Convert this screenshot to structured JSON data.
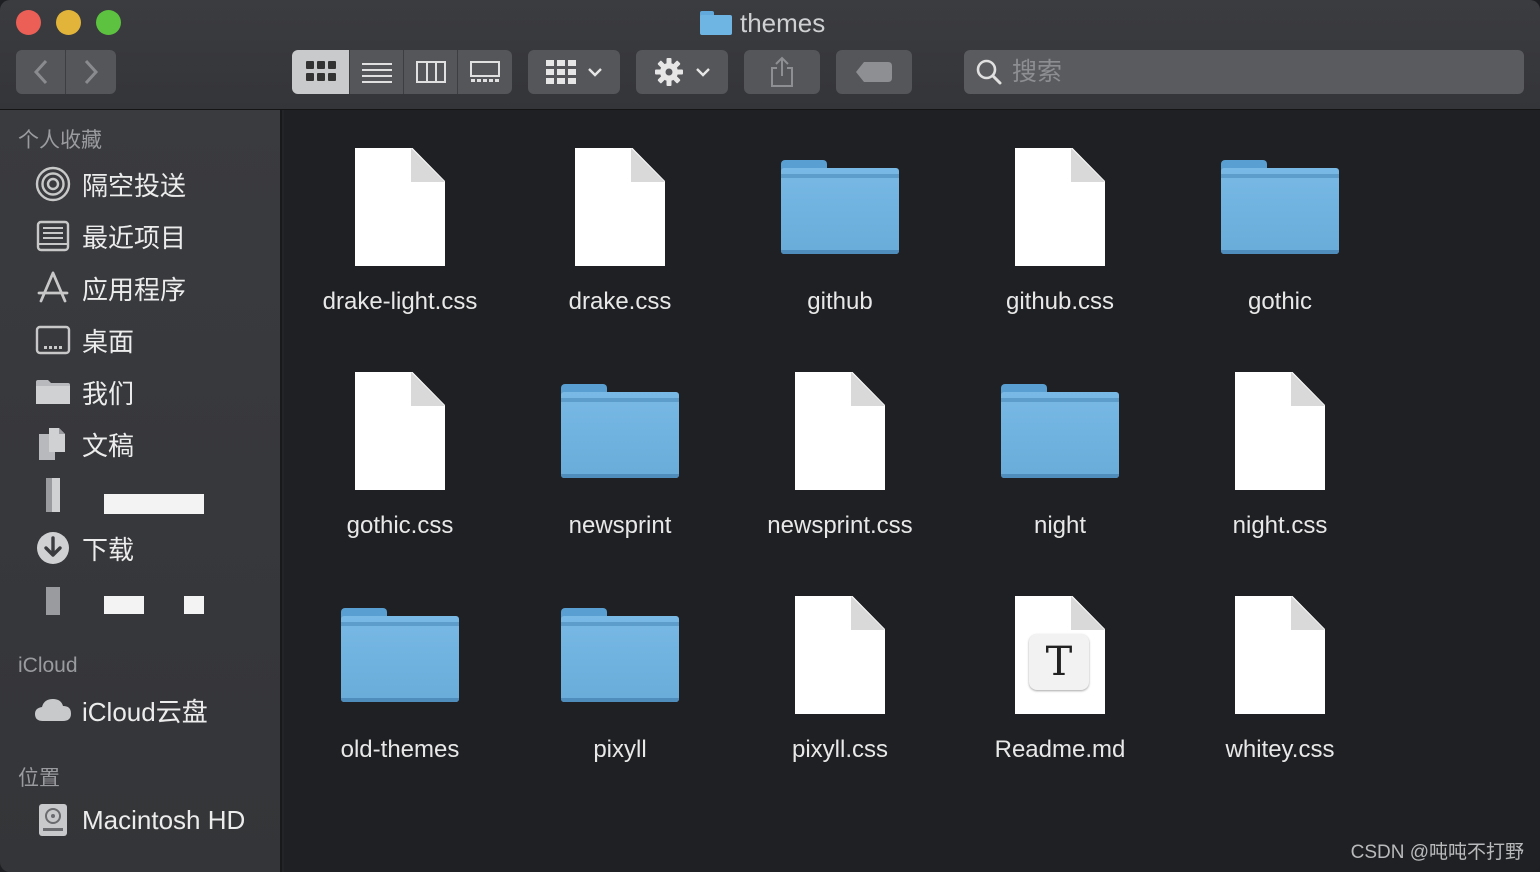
{
  "window": {
    "title": "themes"
  },
  "toolbar": {
    "search_placeholder": "搜索"
  },
  "sidebar": {
    "favorites_title": "个人收藏",
    "favorites": [
      {
        "label": "隔空投送",
        "icon": "airdrop-icon"
      },
      {
        "label": "最近项目",
        "icon": "recents-icon"
      },
      {
        "label": "应用程序",
        "icon": "applications-icon"
      },
      {
        "label": "桌面",
        "icon": "desktop-icon"
      },
      {
        "label": "我们",
        "icon": "folder-icon"
      },
      {
        "label": "文稿",
        "icon": "documents-icon"
      },
      {
        "label": "下载",
        "icon": "downloads-icon"
      }
    ],
    "icloud_title": "iCloud",
    "icloud_items": [
      {
        "label": "iCloud云盘",
        "icon": "cloud-icon"
      }
    ],
    "locations_title": "位置",
    "locations": [
      {
        "label": "Macintosh HD",
        "icon": "hard-disk-icon"
      }
    ]
  },
  "files": [
    {
      "name": "drake-light.css",
      "kind": "document"
    },
    {
      "name": "drake.css",
      "kind": "document"
    },
    {
      "name": "github",
      "kind": "folder"
    },
    {
      "name": "github.css",
      "kind": "document"
    },
    {
      "name": "gothic",
      "kind": "folder"
    },
    {
      "name": "gothic.css",
      "kind": "document"
    },
    {
      "name": "newsprint",
      "kind": "folder"
    },
    {
      "name": "newsprint.css",
      "kind": "document"
    },
    {
      "name": "night",
      "kind": "folder"
    },
    {
      "name": "night.css",
      "kind": "document"
    },
    {
      "name": "old-themes",
      "kind": "folder"
    },
    {
      "name": "pixyll",
      "kind": "folder"
    },
    {
      "name": "pixyll.css",
      "kind": "document"
    },
    {
      "name": "Readme.md",
      "kind": "text",
      "badge": "T"
    },
    {
      "name": "whitey.css",
      "kind": "document"
    }
  ],
  "watermark": "CSDN @吨吨不打野",
  "colors": {
    "folder": "#6fb5e3",
    "close": "#ec5f56",
    "minimize": "#e2b53a",
    "zoom": "#5dc23f"
  }
}
